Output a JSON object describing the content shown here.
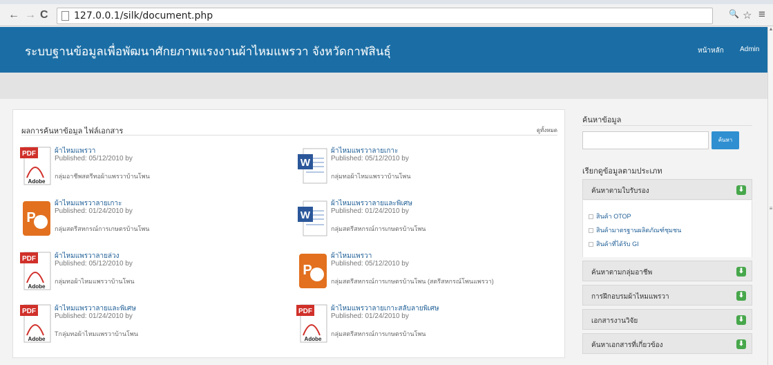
{
  "browser": {
    "url": "127.0.0.1/silk/document.php",
    "back_glyph": "←",
    "forward_glyph": "→",
    "reload_glyph": "C",
    "zoom_glyph": "🔍",
    "star_glyph": "☆",
    "menu_glyph": "≡"
  },
  "header": {
    "title": "ระบบฐานข้อมูลเพื่อพัฒนาศักยภาพแรงงานผ้าไหมแพรวา จังหวัดกาฬสินธุ์",
    "nav": [
      "หน้าหลัก",
      "Admin"
    ],
    "bg_color": "#1b6ea5"
  },
  "results": {
    "title": "ผลการค้นหาข้อมูล ไฟล์เอกสาร",
    "see_all": "ดูทั้งหมด",
    "documents": [
      {
        "title": "ผ้าไหมแพรวา",
        "meta": "Published: 05/12/2010 by",
        "group": "กลุ่มอาชีพสตรีทอผ้าแพรวาบ้านโพน",
        "type": "pdf"
      },
      {
        "title": "ผ้าไหมแพรวาลายเกาะ",
        "meta": "Published: 05/12/2010 by",
        "group": "กลุ่มทอผ้าไหมแพรวาบ้านโพน",
        "type": "word"
      },
      {
        "title": "ผ้าไหมแพรวาลายเกาะ",
        "meta": "Published: 01/24/2010 by",
        "group": "กลุ่มสตรีสหกรณ์การเกษตรบ้านโพน",
        "type": "ppt"
      },
      {
        "title": "ผ้าไหมแพรวาลายและพิเศษ",
        "meta": "Published: 01/24/2010 by",
        "group": "กลุ่มสตรีสหกรณ์การเกษตรบ้านโพน",
        "type": "word"
      },
      {
        "title": "ผ้าไหมแพรวาลายล่วง",
        "meta": "Published: 05/12/2010 by",
        "group": "กลุ่มทอผ้าไหมแพรวาบ้านโพน",
        "type": "pdf"
      },
      {
        "title": "ผ้าไหมแพรวา",
        "meta": "Published: 05/12/2010 by",
        "group": "กลุ่มสตรีสหกรณ์การเกษตรบ้านโพน (สตรีสหกรณ์โพนแพรวา)",
        "type": "ppt"
      },
      {
        "title": "ผ้าไหมแพรวาลายและพิเศษ",
        "meta": "Published: 01/24/2010 by",
        "group": "Tกลุ่มทอผ้าไหมแพรวาบ้านโพน",
        "type": "pdf"
      },
      {
        "title": "ผ้าไหมแพรวาลายเกาะสลับลายพิเศษ",
        "meta": "Published: 01/24/2010 by",
        "group": "กลุ่มสตรีสหกรณ์การเกษตรบ้านโพน",
        "type": "pdf"
      }
    ]
  },
  "icons": {
    "pdf_label": "PDF",
    "adobe_label": "Adobe",
    "word_label": "W",
    "ppt_label": "P",
    "pdf_color": "#d0302a",
    "word_color": "#2b579a",
    "ppt_color": "#e2701f"
  },
  "sidebar": {
    "search_heading": "ค้นหาข้อมูล",
    "search_placeholder": "",
    "search_button": "ค้นหา",
    "browse_heading": "เรียกดูข้อมูลตามประเภท",
    "expanded": {
      "label": "ค้นหาตามใบรับรอง",
      "items": [
        "สินค้า OTOP",
        "สินค้ามาตรฐานผลิตภัณฑ์ชุมชน",
        "สินค้าที่ได้รับ GI"
      ]
    },
    "sections": [
      "ค้นหาตามกลุ่มอาชีพ",
      "การฝึกอบรมผ้าไหมแพรวา",
      "เอกสารงานวิจัย",
      "ค้นหาเอกสารที่เกี่ยวข้อง"
    ],
    "expand_glyph": "⬇",
    "accent_color": "#47a74b"
  }
}
